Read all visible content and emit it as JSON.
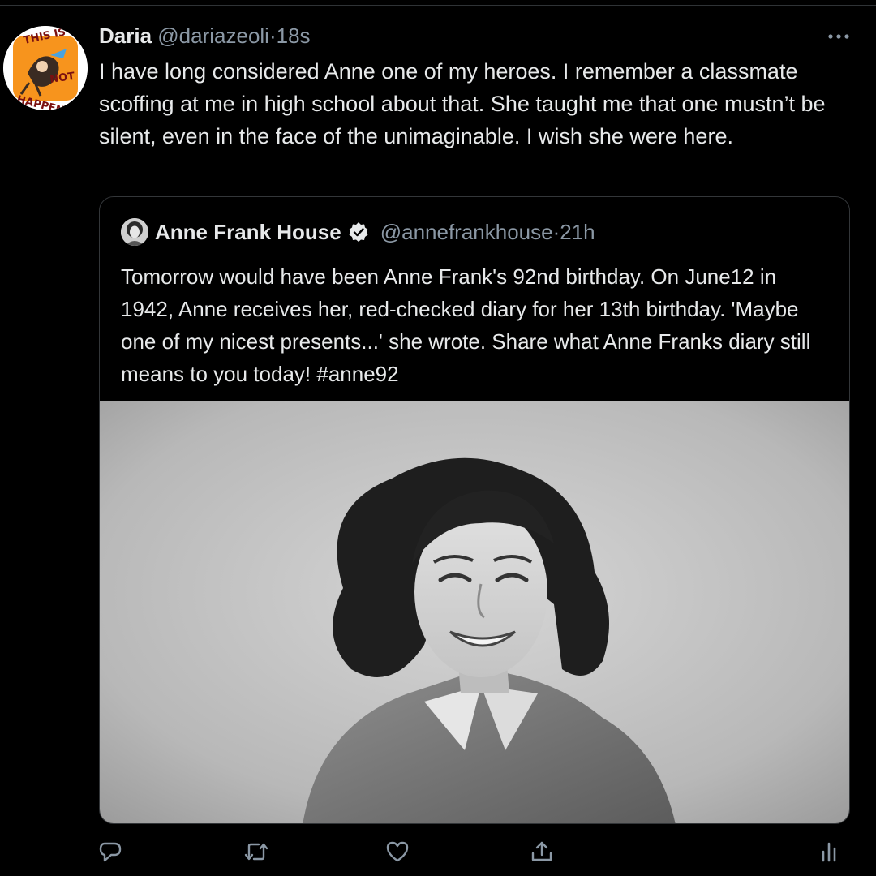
{
  "tweet": {
    "author_name": "Daria",
    "handle": "@dariazeoli",
    "separator": "·",
    "time": "18s",
    "avatar_text": "THIS IS NOT HAPPENING",
    "text": "I have long considered Anne one of my heroes. I remember a classmate scoffing at me in high school about that. She taught me that one mustn’t be silent, even in the face of the unimaginable. I wish she were here.",
    "more_icon": "more-horizontal-icon"
  },
  "quote": {
    "author_name": "Anne Frank House",
    "verified_icon": "verified-badge-icon",
    "handle": "@annefrankhouse",
    "separator": "·",
    "time": "21h",
    "text_main": "Tomorrow would have been Anne Frank's 92nd birthday. On June12 in 1942, Anne receives her, red-checked diary for her 13th birthday. 'Maybe one of my nicest presents...' she wrote. Share what Anne Franks diary still means to you today! ",
    "hashtag": "#anne92"
  },
  "actions": [
    {
      "name": "reply-button",
      "icon": "comment-icon"
    },
    {
      "name": "retweet-button",
      "icon": "retweet-icon"
    },
    {
      "name": "like-button",
      "icon": "heart-icon"
    },
    {
      "name": "share-button",
      "icon": "share-icon"
    },
    {
      "name": "analytics-button",
      "icon": "analytics-icon"
    }
  ],
  "colors": {
    "background": "#000000",
    "text_primary": "#e7e9ea",
    "text_secondary": "#8b98a5",
    "border": "#333639",
    "avatar_orange": "#f7941d"
  }
}
